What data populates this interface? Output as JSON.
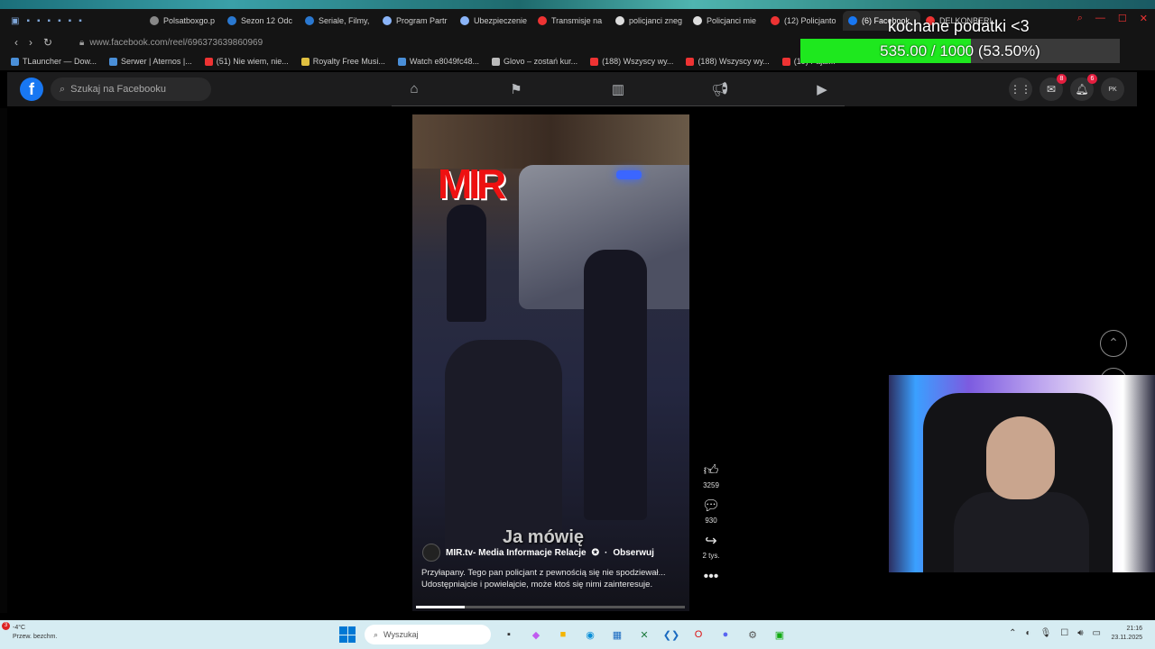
{
  "browser": {
    "tabs": [
      {
        "label": "Polsatboxgo.p",
        "color": "#888"
      },
      {
        "label": "Sezon 12 Odc",
        "color": "#2a78d0"
      },
      {
        "label": "Seriale, Filmy,",
        "color": "#2a78d0"
      },
      {
        "label": "Program Partr",
        "color": "#8ab4f8"
      },
      {
        "label": "Ubezpieczenie",
        "color": "#8ab4f8"
      },
      {
        "label": "Transmisje na",
        "color": "#e33"
      },
      {
        "label": "policjanci zneg",
        "color": "#ddd"
      },
      {
        "label": "Policjanci mie",
        "color": "#ddd"
      },
      {
        "label": "(12) Policjanto",
        "color": "#e33"
      },
      {
        "label": "(6) Facebook",
        "color": "#1877f2"
      },
      {
        "label": "DELKONBERI",
        "color": "#e33"
      }
    ],
    "url": "www.facebook.com/reel/696373639860969",
    "bookmarks": [
      {
        "label": "TLauncher — Dow...",
        "color": "#4a8fd8"
      },
      {
        "label": "Serwer | Aternos |...",
        "color": "#4a8fd8"
      },
      {
        "label": "(51) Nie wiem, nie...",
        "color": "#e33"
      },
      {
        "label": "Royalty Free Musi...",
        "color": "#e0c040"
      },
      {
        "label": "Watch e8049fc48...",
        "color": "#4a8fd8"
      },
      {
        "label": "Glovo – zostań kur...",
        "color": "#bbb"
      },
      {
        "label": "(188) Wszyscy wy...",
        "color": "#e33"
      },
      {
        "label": "(188) Wszyscy wy...",
        "color": "#e33"
      },
      {
        "label": "(19) Pajal...",
        "color": "#e33"
      }
    ]
  },
  "overlay": {
    "title": "kochane podatki <3",
    "progress_text": "535.00 / 1000 (53.50%)",
    "progress_fraction": 0.535
  },
  "facebook": {
    "logo": "f",
    "search_placeholder": "Szukaj na Facebooku",
    "nav_icons": [
      "home-icon",
      "flag-icon",
      "marketplace-icon",
      "megaphone-icon",
      "video-icon"
    ],
    "messenger_badge": "8",
    "notifications_badge": "6",
    "profile_initials": "PK"
  },
  "reel": {
    "logo_text": "MIR",
    "caption_overlay": "Ja mówię",
    "author": "MIR.tv- Media Informacje Relacje",
    "follow": "Obserwuj",
    "description_line1": "Przyłapany. Tego pan policjant z pewnością się nie spodziewał...",
    "description_line2": "Udostępniajcie i powielajcie, może ktoś się nimi zainteresuje.",
    "progress_fraction": 0.18,
    "likes": "3259",
    "comments": "930",
    "shares": "2 tys."
  },
  "taskbar": {
    "weather_badge": "3",
    "temperature": "-4°C",
    "weather_desc": "Przew. bezchm.",
    "search_placeholder": "Wyszukaj",
    "time": "21:16",
    "date": "23.11.2025"
  }
}
